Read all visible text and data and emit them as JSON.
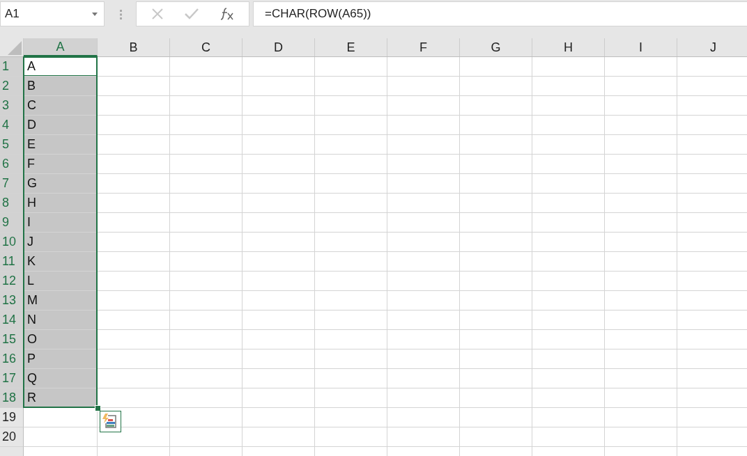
{
  "name_box": {
    "value": "A1"
  },
  "formula_bar": {
    "value": "=CHAR(ROW(A65))"
  },
  "columns": [
    {
      "label": "A",
      "selected": true
    },
    {
      "label": "B",
      "selected": false
    },
    {
      "label": "C",
      "selected": false
    },
    {
      "label": "D",
      "selected": false
    },
    {
      "label": "E",
      "selected": false
    },
    {
      "label": "F",
      "selected": false
    },
    {
      "label": "G",
      "selected": false
    },
    {
      "label": "H",
      "selected": false
    },
    {
      "label": "I",
      "selected": false
    },
    {
      "label": "J",
      "selected": false
    }
  ],
  "rows": [
    {
      "header": "1",
      "value": "A",
      "selected": true,
      "active": true
    },
    {
      "header": "2",
      "value": "B",
      "selected": true,
      "active": false
    },
    {
      "header": "3",
      "value": "C",
      "selected": true,
      "active": false
    },
    {
      "header": "4",
      "value": "D",
      "selected": true,
      "active": false
    },
    {
      "header": "5",
      "value": "E",
      "selected": true,
      "active": false
    },
    {
      "header": "6",
      "value": "F",
      "selected": true,
      "active": false
    },
    {
      "header": "7",
      "value": "G",
      "selected": true,
      "active": false
    },
    {
      "header": "8",
      "value": "H",
      "selected": true,
      "active": false
    },
    {
      "header": "9",
      "value": "I",
      "selected": true,
      "active": false
    },
    {
      "header": "10",
      "value": "J",
      "selected": true,
      "active": false
    },
    {
      "header": "11",
      "value": "K",
      "selected": true,
      "active": false
    },
    {
      "header": "12",
      "value": "L",
      "selected": true,
      "active": false
    },
    {
      "header": "13",
      "value": "M",
      "selected": true,
      "active": false
    },
    {
      "header": "14",
      "value": "N",
      "selected": true,
      "active": false
    },
    {
      "header": "15",
      "value": "O",
      "selected": true,
      "active": false
    },
    {
      "header": "16",
      "value": "P",
      "selected": true,
      "active": false
    },
    {
      "header": "17",
      "value": "Q",
      "selected": true,
      "active": false
    },
    {
      "header": "18",
      "value": "R",
      "selected": true,
      "active": false
    },
    {
      "header": "19",
      "selected": false,
      "active": false
    },
    {
      "header": "20",
      "selected": false,
      "active": false
    }
  ]
}
